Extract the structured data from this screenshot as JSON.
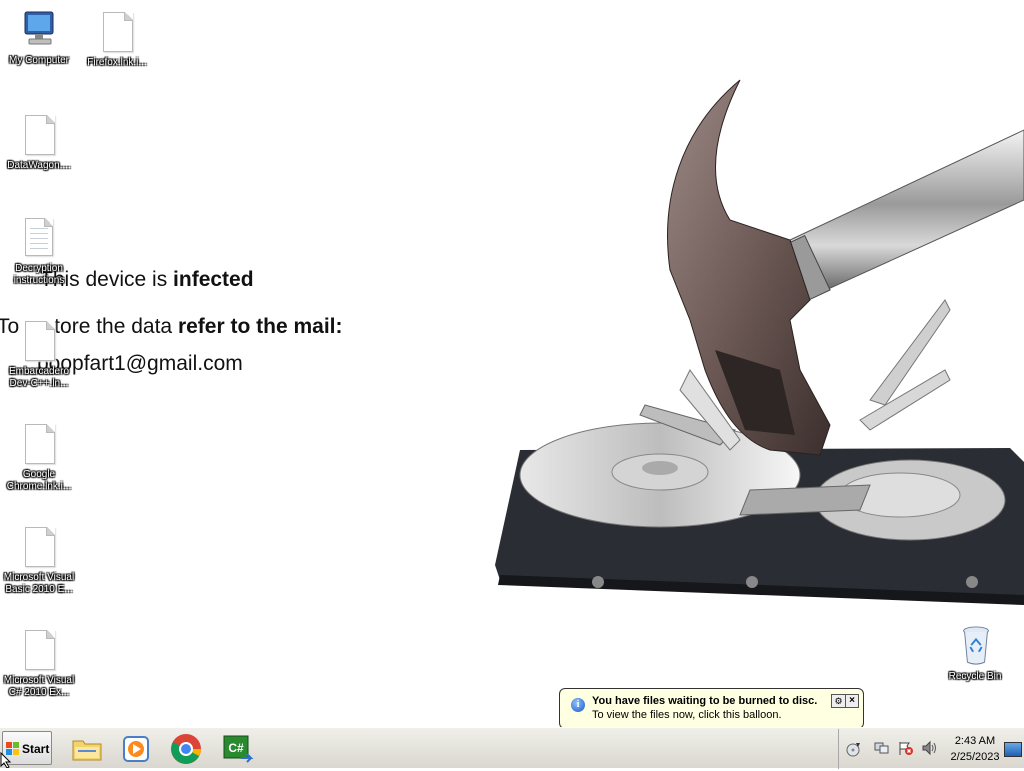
{
  "wallpaper": {
    "line1_pre": "This device is ",
    "line1_bold": "infected",
    "line2_pre": "To restore the data ",
    "line2_bold": "refer to the mail:",
    "line3": "poopfart1@gmail.com"
  },
  "desktop_icons": [
    {
      "label": "My Computer",
      "icon": "computer-icon"
    },
    {
      "label": "Firefox.lnk.i...",
      "icon": "file-icon"
    },
    {
      "label": "DataWagon....",
      "icon": "file-icon"
    },
    {
      "label": "Decryption instructions",
      "icon": "text-document-icon"
    },
    {
      "label": "Embarcadero Dev-C++.ln...",
      "icon": "file-icon"
    },
    {
      "label": "Google Chrome.lnk.i...",
      "icon": "file-icon"
    },
    {
      "label": "Microsoft Visual Basic 2010 E...",
      "icon": "file-icon"
    },
    {
      "label": "Microsoft Visual C# 2010 Ex...",
      "icon": "file-icon"
    },
    {
      "label": "Recycle Bin",
      "icon": "recycle-bin-icon"
    }
  ],
  "taskbar": {
    "start_label": "Start",
    "pinned": [
      "windows-explorer-icon",
      "media-player-icon",
      "chrome-icon",
      "visual-csharp-icon"
    ],
    "clock_time": "2:43 AM",
    "clock_date": "2/25/2023"
  },
  "balloon": {
    "title": "You have files waiting to be burned to disc.",
    "body": "To view the files now, click this balloon."
  },
  "colors": {
    "taskbar_top": "#f0efe9",
    "balloon_bg": "#ffffe1",
    "desktop_bg": "#ffffff"
  }
}
